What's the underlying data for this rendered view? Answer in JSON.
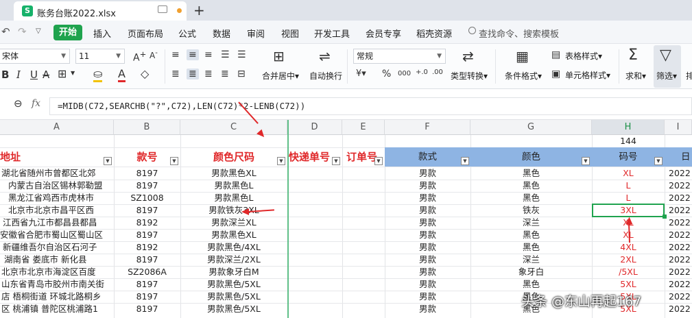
{
  "tab": {
    "icon": "S",
    "title": "账务台账2022.xlsx"
  },
  "menu": {
    "start": "开始",
    "items": [
      "插入",
      "页面布局",
      "公式",
      "数据",
      "审阅",
      "视图",
      "开发工具",
      "会员专享",
      "稻壳资源"
    ],
    "search": "查找命令、搜索模板"
  },
  "ribbon": {
    "font_name": "宋体",
    "font_size": "11",
    "merge": "合并居中",
    "wrap": "自动换行",
    "number_format": "常规",
    "convert": "类型转换",
    "cond_format": "条件格式",
    "table_style": "表格样式",
    "cell_style": "单元格样式",
    "sum": "求和",
    "filter": "筛选",
    "sort": "排"
  },
  "formula_bar": {
    "fx": "fx",
    "formula": "=MIDB(C72,SEARCHB(\"?\",C72),LEN(C72)*2-LENB(C72))"
  },
  "columns": [
    "A",
    "B",
    "C",
    "D",
    "E",
    "F",
    "G",
    "H",
    "I"
  ],
  "summary_row": {
    "H": "144"
  },
  "header_row": {
    "A": "地址",
    "B": "款号",
    "C": "颜色尺码",
    "D": "快递单号",
    "E": "订单号",
    "F": "款式",
    "G": "颜色",
    "H": "码号",
    "I": "日"
  },
  "rows": [
    {
      "A": "湖北省随州市曾都区北郊",
      "B": "8197",
      "C": "男款黑色XL",
      "F": "男款",
      "G": "黑色",
      "H": "XL",
      "I": "2022"
    },
    {
      "A": "内蒙古自治区锡林郭勒盟",
      "B": "8197",
      "C": "男款黑色L",
      "F": "男款",
      "G": "黑色",
      "H": "L",
      "I": "2022"
    },
    {
      "A": "黑龙江省鸡西市虎林市",
      "B": "SZ1008",
      "C": "男款黑色L",
      "F": "男款",
      "G": "黑色",
      "H": "L",
      "I": "2022"
    },
    {
      "A": "北京市北京市昌平区西",
      "B": "8197",
      "C": "男款铁灰3XL",
      "F": "男款",
      "G": "铁灰",
      "H": "3XL",
      "I": "2022"
    },
    {
      "A": "江西省九江市都昌县都昌",
      "B": "8192",
      "C": "男款深兰XL",
      "F": "男款",
      "G": "深兰",
      "H": "XL",
      "I": "2022"
    },
    {
      "A": "安徽省合肥市蜀山区蜀山区",
      "B": "8197",
      "C": "男款黑色XL",
      "F": "男款",
      "G": "黑色",
      "H": "XL",
      "I": "2022"
    },
    {
      "A": "新疆维吾尔自治区石河子",
      "B": "8192",
      "C": "男款黑色/4XL",
      "F": "男款",
      "G": "黑色",
      "H": "4XL",
      "I": "2022"
    },
    {
      "A": "湖南省 娄底市 新化县",
      "B": "8197",
      "C": "男款深兰/2XL",
      "F": "男款",
      "G": "深兰",
      "H": "2XL",
      "I": "2022"
    },
    {
      "A": "北京市北京市海淀区百度",
      "B": "SZ2086A",
      "C": "男款象牙白M",
      "F": "男款",
      "G": "象牙白",
      "H": "/5XL",
      "I": "2022"
    },
    {
      "A": "山东省青岛市胶州市南关街",
      "B": "8197",
      "C": "男款黑色/5XL",
      "F": "男款",
      "G": "黑色",
      "H": "5XL",
      "I": "2022"
    },
    {
      "A": "店 梧桐街道 环城北路桐乡",
      "B": "8197",
      "C": "男款黑色/5XL",
      "F": "男款",
      "G": "黑色",
      "H": "5XL",
      "I": "2022"
    },
    {
      "A": "区 桃浦镇 普陀区桃浦路1",
      "B": "8197",
      "C": "男款黑色/5XL",
      "F": "男款",
      "G": "黑色",
      "H": "5XL",
      "I": "2022"
    }
  ],
  "watermark": "头条 @东山再起167"
}
